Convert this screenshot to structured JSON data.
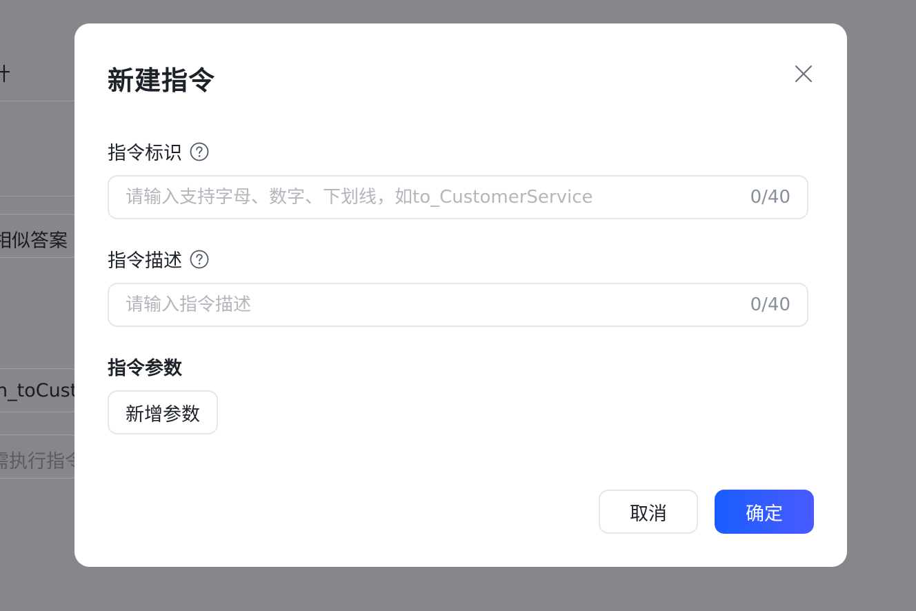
{
  "background": {
    "fragments": [
      "计",
      "相似答案",
      "n_toCust",
      "需执行指令"
    ]
  },
  "dialog": {
    "title": "新建指令",
    "fields": [
      {
        "label": "指令标识",
        "placeholder": "请输入支持字母、数字、下划线，如to_CustomerService",
        "value": "",
        "counter": "0/40"
      },
      {
        "label": "指令描述",
        "placeholder": "请输入指令描述",
        "value": "",
        "counter": "0/40"
      }
    ],
    "params_title": "指令参数",
    "add_param_label": "新增参数",
    "cancel_label": "取消",
    "confirm_label": "确定"
  },
  "icons": {
    "close": "close-icon",
    "help": "help-circle-icon"
  },
  "colors": {
    "overlay": "#86878b",
    "primary": "#1a5cff",
    "primary_end": "#4a5bff",
    "text": "#1d2129",
    "placeholder": "#b3b6bd",
    "border": "#e5e6eb"
  }
}
